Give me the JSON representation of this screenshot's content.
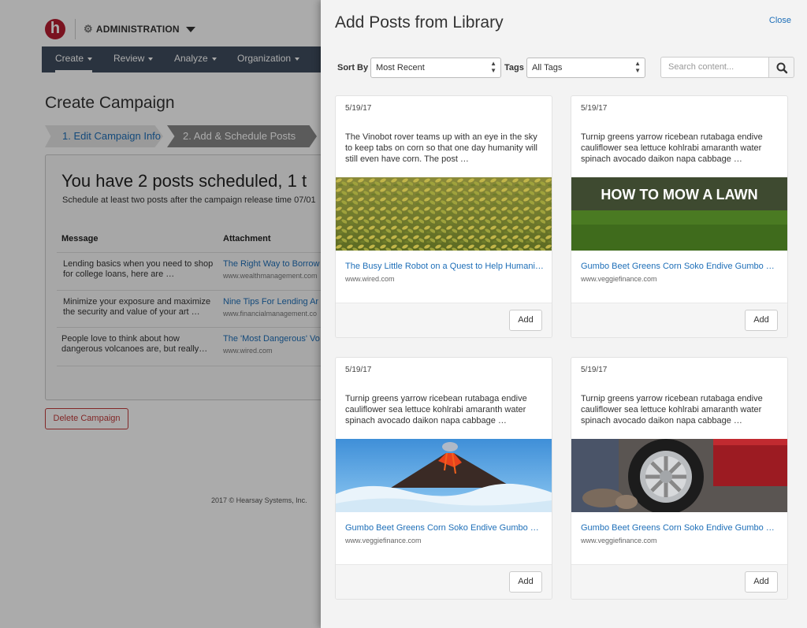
{
  "app": {
    "logo_letter": "h",
    "section_label": "ADMINISTRATION"
  },
  "nav": [
    {
      "label": "Create"
    },
    {
      "label": "Review"
    },
    {
      "label": "Analyze"
    },
    {
      "label": "Organization"
    }
  ],
  "page": {
    "title": "Create Campaign",
    "steps": [
      "1. Edit Campaign Info",
      "2. Add & Schedule Posts"
    ],
    "schedule_title": "You have 2 posts scheduled, 1 t",
    "schedule_note": "Schedule at least two posts after the campaign release time 07/01",
    "columns": {
      "message": "Message",
      "attachment": "Attachment"
    },
    "rows": [
      {
        "message": "Lending basics when you need to shop for college loans, here are …",
        "link": "The Right Way to Borrow",
        "source": "www.wealthmanagement.com"
      },
      {
        "message": "Minimize your exposure and maximize the security and value of your art …",
        "link": "Nine Tips For Lending Ar",
        "source": "www.financialmanagement.co"
      },
      {
        "message": "People love to think about how dangerous volcanoes are, but really…",
        "link": "The 'Most Dangerous' Vo",
        "source": "www.wired.com"
      }
    ],
    "delete_label": "Delete Campaign",
    "copyright": "2017 © Hearsay Systems, Inc."
  },
  "drawer": {
    "title": "Add Posts from Library",
    "close_label": "Close",
    "sort_label": "Sort By",
    "sort_value": "Most Recent",
    "tags_label": "Tags",
    "tags_value": "All Tags",
    "search_placeholder": "Search content...",
    "cards": [
      {
        "date": "5/19/17",
        "body": "The Vinobot rover teams up with an eye in the sky to keep tabs on corn so that one day humanity will still even have corn. The post …",
        "image": "corn-field",
        "title": "The Busy Little Robot on a Quest to Help Humanity…",
        "source": "www.wired.com",
        "add_label": "Add"
      },
      {
        "date": "5/19/17",
        "body": "Turnip greens yarrow ricebean rutabaga endive cauliflower sea lettuce kohlrabi amaranth water spinach avocado daikon napa cabbage …",
        "image": "lawn",
        "image_caption": "HOW TO MOW A LAWN",
        "title": "Gumbo Beet Greens Corn Soko Endive Gumbo …",
        "source": "www.veggiefinance.com",
        "add_label": "Add"
      },
      {
        "date": "5/19/17",
        "body": "Turnip greens yarrow ricebean rutabaga endive cauliflower sea lettuce kohlrabi amaranth water spinach avocado daikon napa cabbage …",
        "image": "volcano",
        "title": "Gumbo Beet Greens Corn Soko Endive Gumbo …",
        "source": "www.veggiefinance.com",
        "add_label": "Add"
      },
      {
        "date": "5/19/17",
        "body": "Turnip greens yarrow ricebean rutabaga endive cauliflower sea lettuce kohlrabi amaranth water spinach avocado daikon napa cabbage …",
        "image": "car-tire",
        "title": "Gumbo Beet Greens Corn Soko Endive Gumbo …",
        "source": "www.veggiefinance.com",
        "add_label": "Add"
      }
    ]
  },
  "colors": {
    "brand": "#b71d31",
    "nav_bg": "#3f4d5e",
    "link": "#1e6fb8",
    "danger": "#c23b3b"
  }
}
